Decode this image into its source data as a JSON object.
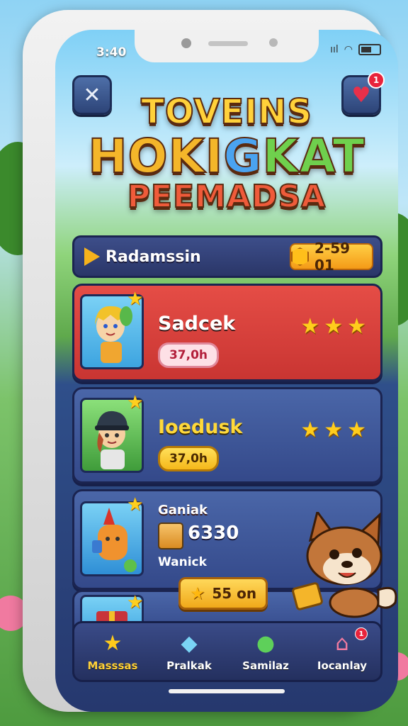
{
  "status": {
    "time": "3:40",
    "signal": "ııl"
  },
  "header_buttons": {
    "close_icon": "✕",
    "heart_icon": "♥",
    "heart_badge": "1"
  },
  "title": {
    "line1": "TOVEINS",
    "line2_a": "HOKI",
    "line2_b": "G",
    "line2_c": "KAT",
    "line3": "PEEMADSA"
  },
  "list_header": {
    "title": "Radamssin",
    "coins": "2-59 01"
  },
  "cards": [
    {
      "name": "Sadcek",
      "time": "37,0h",
      "stars": "★★★"
    },
    {
      "name": "Ioedusk",
      "time": "37,0h",
      "stars": "★★★"
    },
    {
      "name": "Ganiak",
      "value": "6330",
      "sub": "Wanick"
    }
  ],
  "reward": {
    "value": "55 on"
  },
  "tabs": [
    {
      "label": "Masssas",
      "icon": "★"
    },
    {
      "label": "Pralkak",
      "icon": "◆"
    },
    {
      "label": "Samilaz",
      "icon": "●"
    },
    {
      "label": "Iocanlay",
      "icon": "⌂",
      "badge": "1"
    }
  ],
  "colors": {
    "accent": "#ffd13a",
    "red_card": "#e54d46",
    "blue_card": "#4a66a8",
    "coin": "#f49a17"
  }
}
